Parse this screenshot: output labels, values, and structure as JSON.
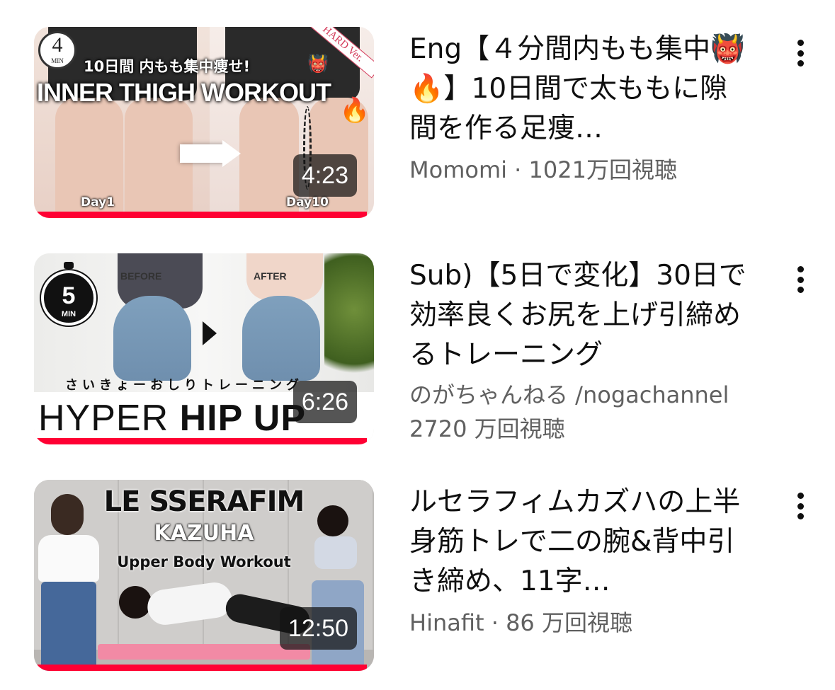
{
  "videos": [
    {
      "title": "Eng【４分間内もも集中👹 🔥】10日間で太ももに隙間を作る足痩…",
      "meta": "Momomi · 1021万回視聴",
      "duration": "4:23",
      "progress": 0.98,
      "thumbnail": {
        "badge_number": "4",
        "badge_unit": "MIN",
        "jp_caption": "10日間 内もも集中痩せ!",
        "en_caption": "INNER THIGH WORKOUT",
        "tag": "HARD Ver.",
        "day_left": "Day1",
        "day_right": "Day10"
      }
    },
    {
      "title": "Sub)【5日で変化】30日で効率良くお尻を上げ引締めるトレーニング",
      "meta": "のがちゃんねる /nogachannel",
      "meta2": "2720 万回視聴",
      "duration": "6:26",
      "progress": 0.98,
      "thumbnail": {
        "timer_number": "5",
        "timer_unit": "MIN",
        "before_label": "BEFORE",
        "after_label": "AFTER",
        "jp_caption": "さいきょーおしりトレーニング",
        "big_light": "HYPER ",
        "big_bold": "HIP UP"
      }
    },
    {
      "title": "ルセラフィムカズハの上半身筋トレで二の腕&背中引き締め、11字…",
      "meta": "Hinafit · 86 万回視聴",
      "duration": "12:50",
      "progress": 0.98,
      "thumbnail": {
        "line1": "LE SSERAFIM",
        "line2": "KAZUHA",
        "line3": "Upper Body Workout"
      }
    }
  ],
  "colors": {
    "progress": "#ff0033",
    "title": "#0f0f0f",
    "meta": "#606060"
  },
  "icons": {
    "more": "vertical-ellipsis"
  }
}
